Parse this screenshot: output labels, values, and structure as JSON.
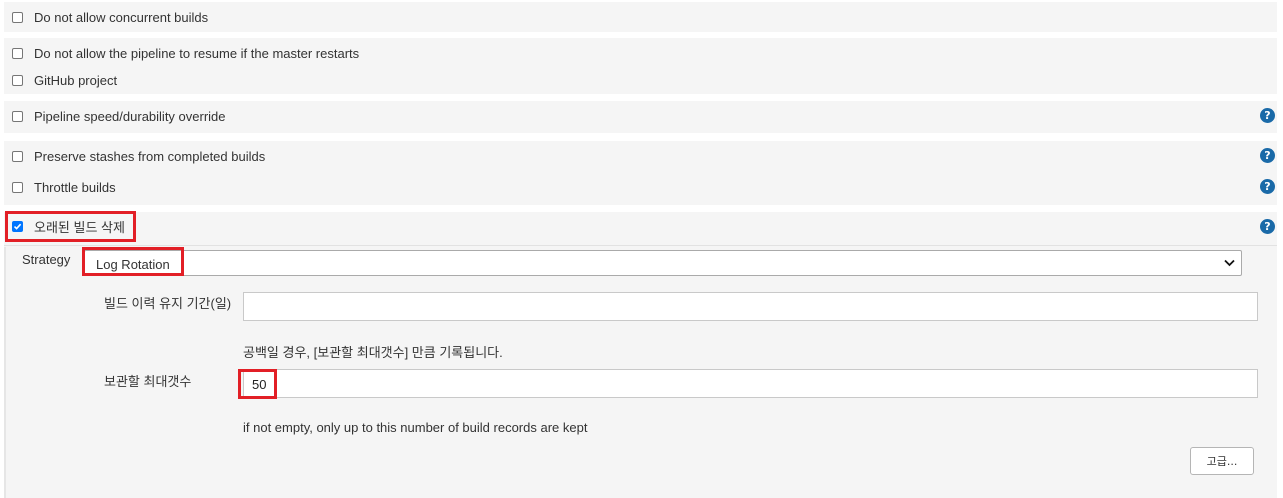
{
  "options": {
    "no_concurrent": {
      "label": "Do not allow concurrent builds",
      "checked": false
    },
    "no_resume": {
      "label": "Do not allow the pipeline to resume if the master restarts",
      "checked": false
    },
    "github_project": {
      "label": "GitHub project",
      "checked": false
    },
    "pipeline_speed": {
      "label": "Pipeline speed/durability override",
      "checked": false
    },
    "preserve_stashes": {
      "label": "Preserve stashes from completed builds",
      "checked": false
    },
    "throttle_builds": {
      "label": "Throttle builds",
      "checked": false
    },
    "discard_old_builds": {
      "label": "오래된 빌드 삭제",
      "checked": true
    }
  },
  "help_icon": {
    "glyph": "?",
    "icon": "question-circle-icon",
    "color": "#1a6aa8"
  },
  "strategy": {
    "label": "Strategy",
    "selected": "Log Rotation"
  },
  "days_to_keep": {
    "label": "빌드 이력 유지 기간(일)",
    "value": "",
    "hint": "공백일 경우, [보관할 최대갯수] 만큼 기록됩니다."
  },
  "max_builds": {
    "label": "보관할 최대갯수",
    "value": "50",
    "hint": "if not empty, only up to this number of build records are kept"
  },
  "advanced_button": {
    "label": "고급..."
  },
  "colors": {
    "highlight": "#e21f26",
    "checkbox_checked": "#0075ff",
    "band": "#f5f5f5"
  }
}
